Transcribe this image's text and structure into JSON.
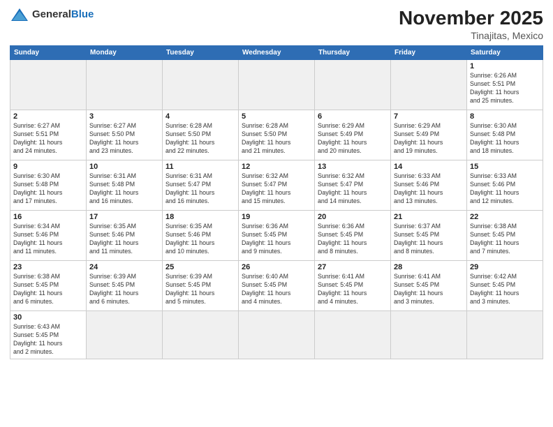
{
  "header": {
    "logo_general": "General",
    "logo_blue": "Blue",
    "month": "November 2025",
    "location": "Tinajitas, Mexico"
  },
  "weekdays": [
    "Sunday",
    "Monday",
    "Tuesday",
    "Wednesday",
    "Thursday",
    "Friday",
    "Saturday"
  ],
  "weeks": [
    [
      {
        "day": "",
        "info": ""
      },
      {
        "day": "",
        "info": ""
      },
      {
        "day": "",
        "info": ""
      },
      {
        "day": "",
        "info": ""
      },
      {
        "day": "",
        "info": ""
      },
      {
        "day": "",
        "info": ""
      },
      {
        "day": "1",
        "info": "Sunrise: 6:26 AM\nSunset: 5:51 PM\nDaylight: 11 hours\nand 25 minutes."
      }
    ],
    [
      {
        "day": "2",
        "info": "Sunrise: 6:27 AM\nSunset: 5:51 PM\nDaylight: 11 hours\nand 24 minutes."
      },
      {
        "day": "3",
        "info": "Sunrise: 6:27 AM\nSunset: 5:50 PM\nDaylight: 11 hours\nand 23 minutes."
      },
      {
        "day": "4",
        "info": "Sunrise: 6:28 AM\nSunset: 5:50 PM\nDaylight: 11 hours\nand 22 minutes."
      },
      {
        "day": "5",
        "info": "Sunrise: 6:28 AM\nSunset: 5:50 PM\nDaylight: 11 hours\nand 21 minutes."
      },
      {
        "day": "6",
        "info": "Sunrise: 6:29 AM\nSunset: 5:49 PM\nDaylight: 11 hours\nand 20 minutes."
      },
      {
        "day": "7",
        "info": "Sunrise: 6:29 AM\nSunset: 5:49 PM\nDaylight: 11 hours\nand 19 minutes."
      },
      {
        "day": "8",
        "info": "Sunrise: 6:30 AM\nSunset: 5:48 PM\nDaylight: 11 hours\nand 18 minutes."
      }
    ],
    [
      {
        "day": "9",
        "info": "Sunrise: 6:30 AM\nSunset: 5:48 PM\nDaylight: 11 hours\nand 17 minutes."
      },
      {
        "day": "10",
        "info": "Sunrise: 6:31 AM\nSunset: 5:48 PM\nDaylight: 11 hours\nand 16 minutes."
      },
      {
        "day": "11",
        "info": "Sunrise: 6:31 AM\nSunset: 5:47 PM\nDaylight: 11 hours\nand 16 minutes."
      },
      {
        "day": "12",
        "info": "Sunrise: 6:32 AM\nSunset: 5:47 PM\nDaylight: 11 hours\nand 15 minutes."
      },
      {
        "day": "13",
        "info": "Sunrise: 6:32 AM\nSunset: 5:47 PM\nDaylight: 11 hours\nand 14 minutes."
      },
      {
        "day": "14",
        "info": "Sunrise: 6:33 AM\nSunset: 5:46 PM\nDaylight: 11 hours\nand 13 minutes."
      },
      {
        "day": "15",
        "info": "Sunrise: 6:33 AM\nSunset: 5:46 PM\nDaylight: 11 hours\nand 12 minutes."
      }
    ],
    [
      {
        "day": "16",
        "info": "Sunrise: 6:34 AM\nSunset: 5:46 PM\nDaylight: 11 hours\nand 11 minutes."
      },
      {
        "day": "17",
        "info": "Sunrise: 6:35 AM\nSunset: 5:46 PM\nDaylight: 11 hours\nand 11 minutes."
      },
      {
        "day": "18",
        "info": "Sunrise: 6:35 AM\nSunset: 5:46 PM\nDaylight: 11 hours\nand 10 minutes."
      },
      {
        "day": "19",
        "info": "Sunrise: 6:36 AM\nSunset: 5:45 PM\nDaylight: 11 hours\nand 9 minutes."
      },
      {
        "day": "20",
        "info": "Sunrise: 6:36 AM\nSunset: 5:45 PM\nDaylight: 11 hours\nand 8 minutes."
      },
      {
        "day": "21",
        "info": "Sunrise: 6:37 AM\nSunset: 5:45 PM\nDaylight: 11 hours\nand 8 minutes."
      },
      {
        "day": "22",
        "info": "Sunrise: 6:38 AM\nSunset: 5:45 PM\nDaylight: 11 hours\nand 7 minutes."
      }
    ],
    [
      {
        "day": "23",
        "info": "Sunrise: 6:38 AM\nSunset: 5:45 PM\nDaylight: 11 hours\nand 6 minutes."
      },
      {
        "day": "24",
        "info": "Sunrise: 6:39 AM\nSunset: 5:45 PM\nDaylight: 11 hours\nand 6 minutes."
      },
      {
        "day": "25",
        "info": "Sunrise: 6:39 AM\nSunset: 5:45 PM\nDaylight: 11 hours\nand 5 minutes."
      },
      {
        "day": "26",
        "info": "Sunrise: 6:40 AM\nSunset: 5:45 PM\nDaylight: 11 hours\nand 4 minutes."
      },
      {
        "day": "27",
        "info": "Sunrise: 6:41 AM\nSunset: 5:45 PM\nDaylight: 11 hours\nand 4 minutes."
      },
      {
        "day": "28",
        "info": "Sunrise: 6:41 AM\nSunset: 5:45 PM\nDaylight: 11 hours\nand 3 minutes."
      },
      {
        "day": "29",
        "info": "Sunrise: 6:42 AM\nSunset: 5:45 PM\nDaylight: 11 hours\nand 3 minutes."
      }
    ],
    [
      {
        "day": "30",
        "info": "Sunrise: 6:43 AM\nSunset: 5:45 PM\nDaylight: 11 hours\nand 2 minutes."
      },
      {
        "day": "",
        "info": ""
      },
      {
        "day": "",
        "info": ""
      },
      {
        "day": "",
        "info": ""
      },
      {
        "day": "",
        "info": ""
      },
      {
        "day": "",
        "info": ""
      },
      {
        "day": "",
        "info": ""
      }
    ]
  ]
}
